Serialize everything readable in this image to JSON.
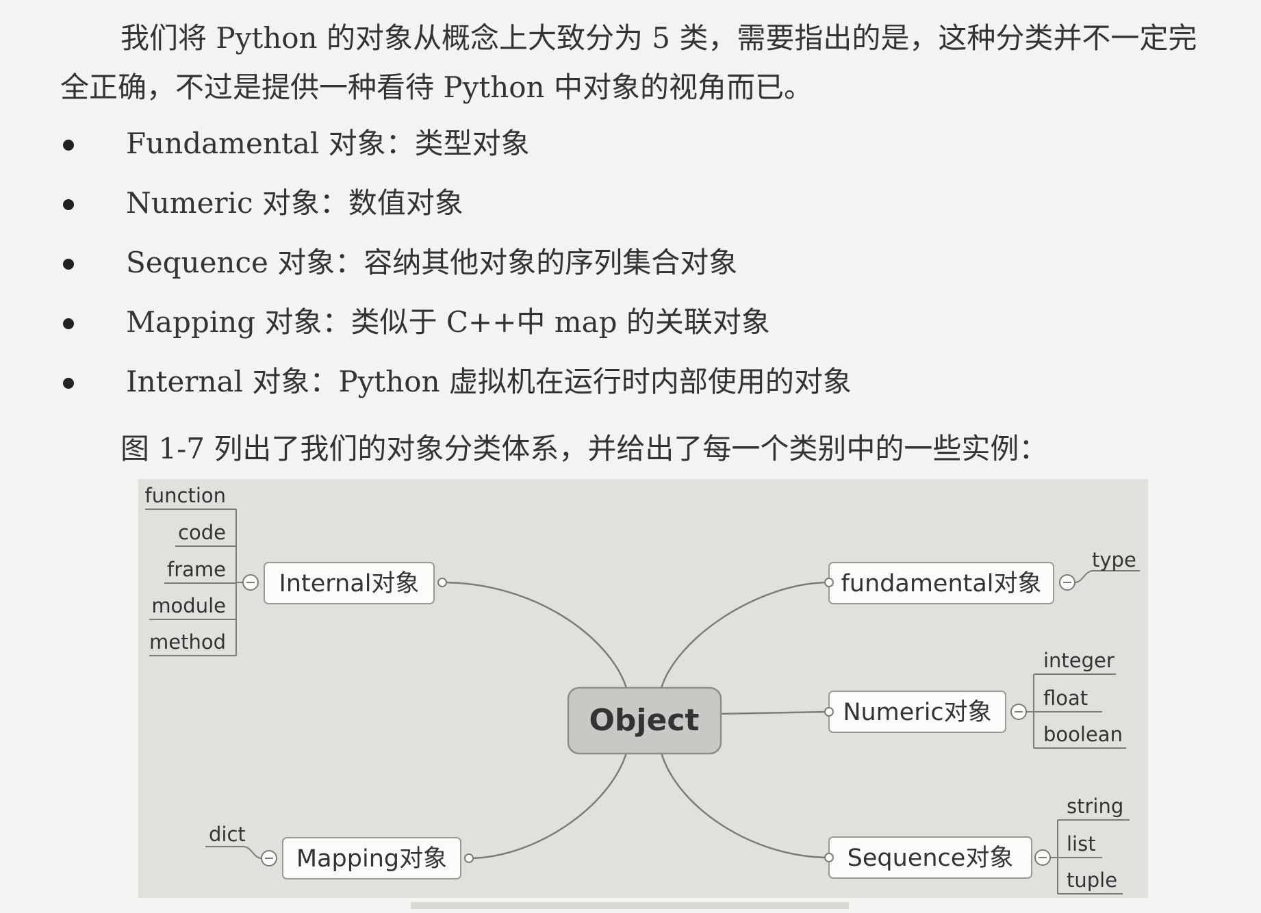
{
  "intro": {
    "line1": "我们将 Python 的对象从概念上大致分为 5 类，需要指出的是，这种分类并不一定完",
    "line2": "全正确，不过是提供一种看待 Python 中对象的视角而已。"
  },
  "bullets": [
    {
      "label": "Fundamental 对象：类型对象"
    },
    {
      "label": "Numeric 对象：数值对象"
    },
    {
      "label": "Sequence 对象：容纳其他对象的序列集合对象"
    },
    {
      "label": "Mapping 对象：类似于 C++中 map 的关联对象"
    },
    {
      "label": "Internal 对象：Python 虚拟机在运行时内部使用的对象"
    }
  ],
  "figure_intro": "图 1-7 列出了我们的对象分类体系，并给出了每一个类别中的一些实例：",
  "mindmap": {
    "center": "Object",
    "branches": {
      "internal": {
        "label": "Internal对象",
        "items": [
          "function",
          "code",
          "frame",
          "module",
          "method"
        ]
      },
      "mapping": {
        "label": "Mapping对象",
        "items": [
          "dict"
        ]
      },
      "fundamental": {
        "label": "fundamental对象",
        "items": [
          "type"
        ]
      },
      "numeric": {
        "label": "Numeric对象",
        "items": [
          "integer",
          "float",
          "boolean"
        ]
      },
      "sequence": {
        "label": "Sequence对象",
        "items": [
          "string",
          "list",
          "tuple"
        ]
      }
    }
  },
  "colors": {
    "page_bg": "#f4f3f1",
    "figure_bg": "#e1e0dd",
    "center_fill": "#c9c8c5",
    "node_fill": "#fbfbfa",
    "line": "#7c7b78"
  }
}
